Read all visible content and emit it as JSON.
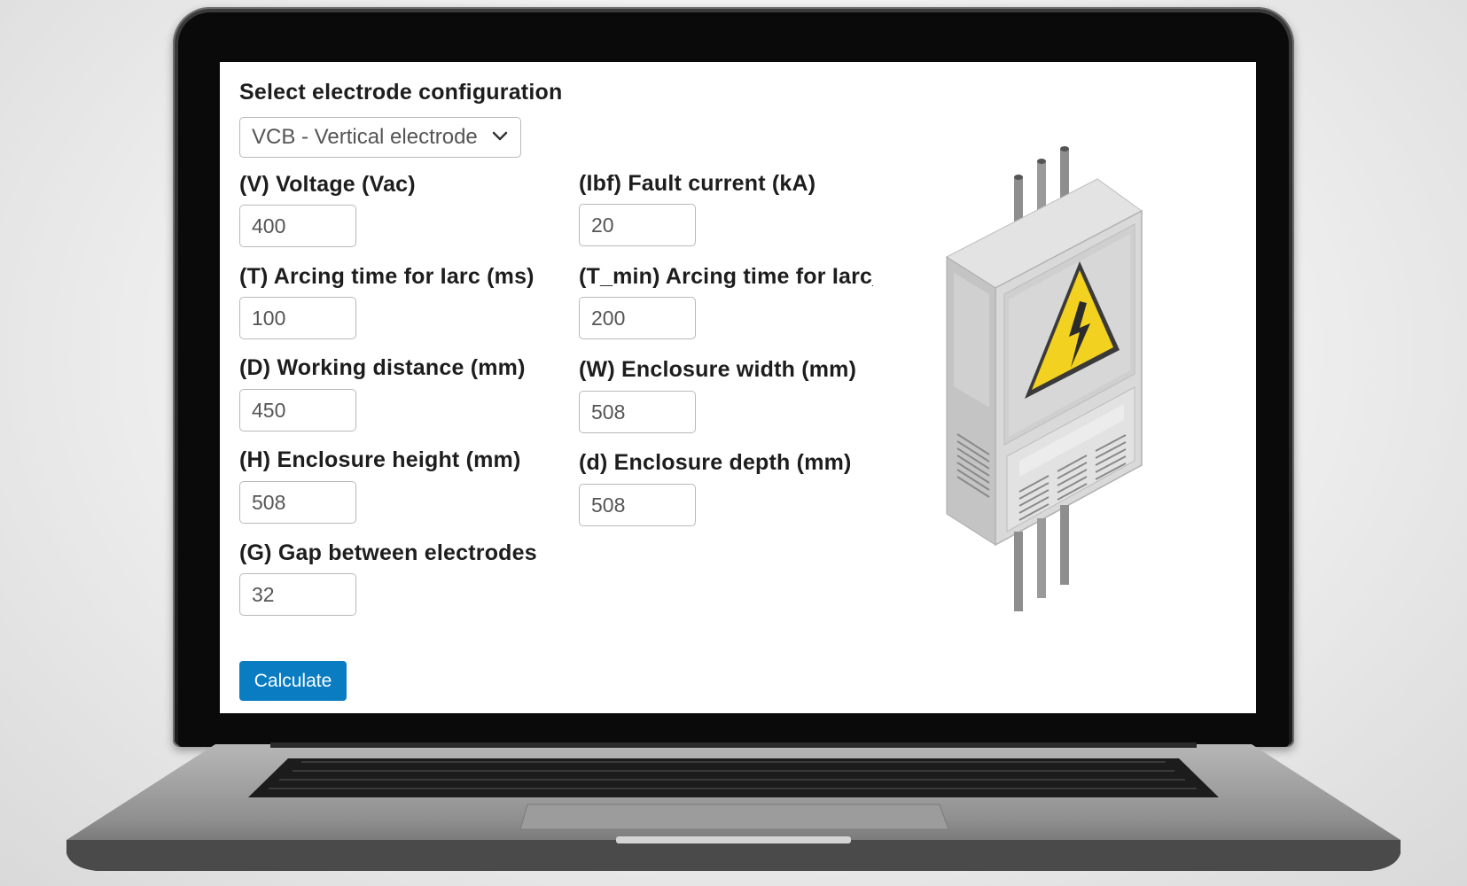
{
  "form": {
    "config_label": "Select electrode configuration",
    "config_selected": "VCB - Vertical electrode",
    "fields": [
      {
        "label": "(V) Voltage (Vac)",
        "value": "400"
      },
      {
        "label": "(Ibf) Fault current (kA)",
        "value": "20"
      },
      {
        "label": "(T) Arcing time for Iarc (ms)",
        "value": "100"
      },
      {
        "label": "(T_min) Arcing time for Iarc_min (ms)",
        "value": "200"
      },
      {
        "label": "(D) Working distance (mm)",
        "value": "450"
      },
      {
        "label": "(W) Enclosure width (mm)",
        "value": "508"
      },
      {
        "label": "(H) Enclosure height (mm)",
        "value": "508"
      },
      {
        "label": "(d) Enclosure depth (mm)",
        "value": "508"
      },
      {
        "label": "(G) Gap between electrodes",
        "value": "32"
      }
    ],
    "calculate_label": "Calculate"
  },
  "illustration": {
    "icon": "electrical-cabinet-icon",
    "warning_color": "#f2d120",
    "body_color": "#d6d6d6"
  }
}
